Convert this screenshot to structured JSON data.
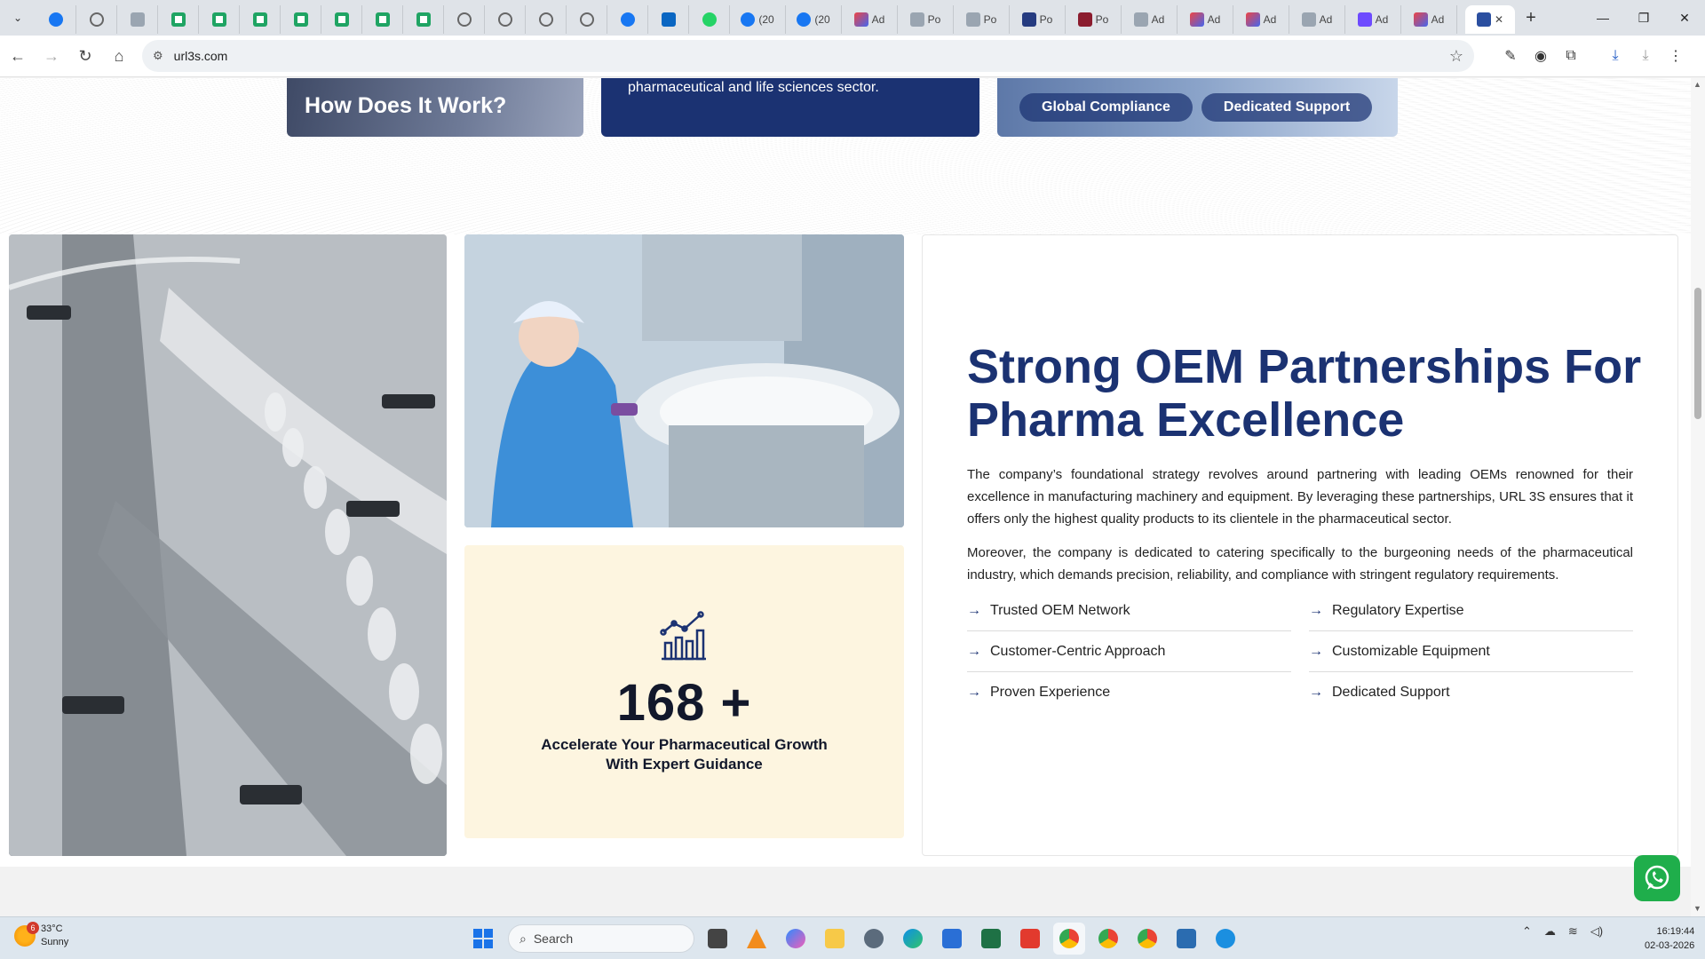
{
  "browser": {
    "tabs": [
      {
        "icon": "meta-icon",
        "kind": "mini"
      },
      {
        "icon": "gear-icon",
        "kind": "mini"
      },
      {
        "icon": "image-icon",
        "kind": "mini"
      },
      {
        "icon": "sheets-icon",
        "kind": "mini"
      },
      {
        "icon": "sheets-icon",
        "kind": "mini"
      },
      {
        "icon": "sheets-icon",
        "kind": "mini"
      },
      {
        "icon": "sheets-icon",
        "kind": "mini"
      },
      {
        "icon": "sheets-icon",
        "kind": "mini"
      },
      {
        "icon": "sheets-icon",
        "kind": "mini"
      },
      {
        "icon": "sheets-icon",
        "kind": "mini"
      },
      {
        "icon": "gear-icon",
        "kind": "mini"
      },
      {
        "icon": "gear-icon",
        "kind": "mini"
      },
      {
        "icon": "gear-icon",
        "kind": "mini"
      },
      {
        "icon": "gear-icon",
        "kind": "mini"
      },
      {
        "icon": "facebook-icon",
        "kind": "mini"
      },
      {
        "icon": "linkedin-icon",
        "kind": "mini"
      },
      {
        "icon": "whatsapp-icon",
        "kind": "mini"
      },
      {
        "icon": "facebook-icon",
        "kind": "wide",
        "label": "(20"
      },
      {
        "icon": "facebook-icon",
        "kind": "wide",
        "label": "(20"
      },
      {
        "icon": "mixed-icon",
        "kind": "wide",
        "label": "Ad"
      },
      {
        "icon": "page-icon",
        "kind": "wide",
        "label": "Po"
      },
      {
        "icon": "page-icon",
        "kind": "wide",
        "label": "Po"
      },
      {
        "icon": "paypal-icon",
        "kind": "wide",
        "label": "Po"
      },
      {
        "icon": "red-icon",
        "kind": "wide",
        "label": "Po"
      },
      {
        "icon": "page-icon",
        "kind": "wide",
        "label": "Ad"
      },
      {
        "icon": "mixed-icon",
        "kind": "wide",
        "label": "Ad"
      },
      {
        "icon": "mixed-icon",
        "kind": "wide",
        "label": "Ad"
      },
      {
        "icon": "page-icon",
        "kind": "wide",
        "label": "Ad"
      },
      {
        "icon": "square-icon",
        "kind": "wide",
        "label": "Ad"
      },
      {
        "icon": "circle-icon",
        "kind": "wide",
        "label": "Ad"
      }
    ],
    "active_tab_icon": "url3s-icon",
    "new_tab": "+",
    "url": "url3s.com",
    "window_buttons": {
      "minimize": "—",
      "restore": "❐",
      "close": "✕"
    }
  },
  "page": {
    "top_cards": {
      "how_title": "How Does It Work?",
      "pharma_text": "pharmaceutical and life sciences sector.",
      "pills": [
        "Global Compliance",
        "Dedicated Support"
      ]
    },
    "stat": {
      "number": "168 +",
      "caption": "Accelerate Your Pharmaceutical Growth With Expert Guidance",
      "icon": "growth-chart-icon"
    },
    "info": {
      "title": "Strong OEM Partnerships For Pharma Excellence",
      "paragraph1": "The company’s foundational strategy revolves around partnering with leading OEMs renowned for their excellence in manufacturing machinery and equipment. By leveraging these partnerships, URL 3S ensures that it offers only the highest quality products to its clientele in the pharmaceutical sector.",
      "paragraph2": "Moreover, the company is dedicated to catering specifically to the burgeoning needs of the pharmaceutical industry, which demands precision, reliability, and compliance with stringent regulatory requirements.",
      "features": [
        "Trusted OEM Network",
        "Regulatory Expertise",
        "Customer-Centric Approach",
        "Customizable Equipment",
        "Proven Experience",
        "Dedicated Support"
      ]
    },
    "accent_colors": {
      "navy": "#1b3272",
      "cream": "#fdf5e0",
      "whatsapp": "#1fae4b"
    }
  },
  "taskbar": {
    "weather": {
      "temp": "33°C",
      "condition": "Sunny",
      "badge": "6"
    },
    "search_placeholder": "Search",
    "time": "16:19:44",
    "date": "02-03-2026"
  }
}
